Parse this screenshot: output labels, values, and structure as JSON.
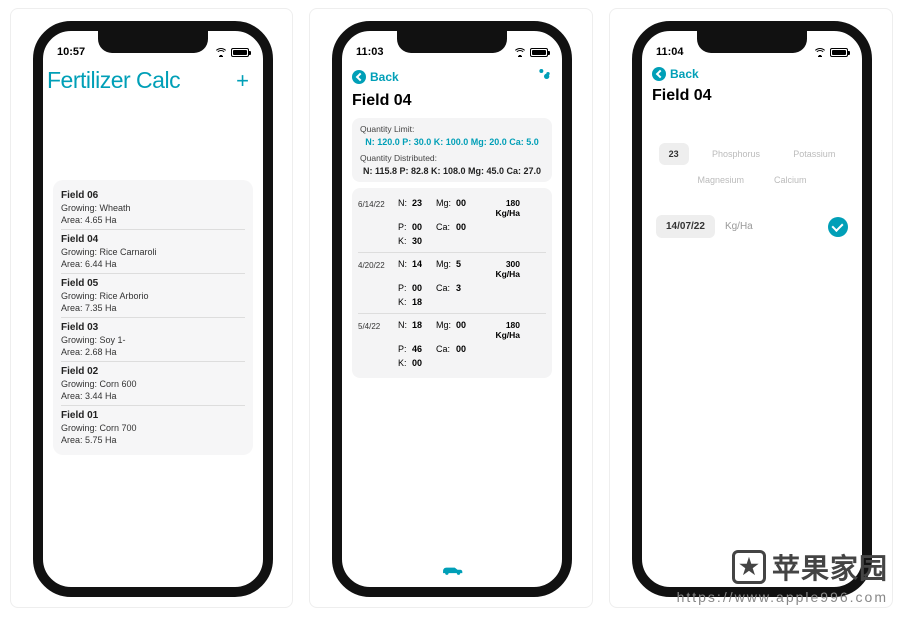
{
  "accent": "#009fb7",
  "watermark": {
    "text": "苹果家园",
    "url": "https://www.apple996.com"
  },
  "screen1": {
    "time": "10:57",
    "title": "Fertilizer Calc",
    "add_label": "+",
    "fields": [
      {
        "name": "Field 06",
        "crop": "Wheath",
        "area": "4.65 Ha"
      },
      {
        "name": "Field 04",
        "crop": "Rice Carnaroli",
        "area": "6.44 Ha"
      },
      {
        "name": "Field 05",
        "crop": "Rice Arborio",
        "area": "7.35 Ha"
      },
      {
        "name": "Field 03",
        "crop": "Soy 1-",
        "area": "2.68 Ha"
      },
      {
        "name": "Field 02",
        "crop": "Corn 600",
        "area": "3.44 Ha"
      },
      {
        "name": "Field 01",
        "crop": "Corn 700",
        "area": "5.75 Ha"
      }
    ]
  },
  "screen2": {
    "time": "11:03",
    "back": "Back",
    "title": "Field 04",
    "limit_label": "Quantity Limit:",
    "limit_value": "N: 120.0 P: 30.0 K: 100.0 Mg: 20.0 Ca: 5.0",
    "dist_label": "Quantity Distributed:",
    "dist_value": "N: 115.8 P: 82.8 K: 108.0 Mg: 45.0 Ca: 27.0",
    "entries": [
      {
        "date": "6/14/22",
        "N": "23",
        "P": "00",
        "K": "30",
        "Mg": "00",
        "Ca": "00",
        "rate": "180 Kg/Ha"
      },
      {
        "date": "4/20/22",
        "N": "14",
        "P": "00",
        "K": "18",
        "Mg": "5",
        "Ca": "3",
        "rate": "300 Kg/Ha"
      },
      {
        "date": "5/4/22",
        "N": "18",
        "P": "46",
        "K": "00",
        "Mg": "00",
        "Ca": "00",
        "rate": "180 Kg/Ha"
      }
    ],
    "labels": {
      "N": "N:",
      "P": "P:",
      "K": "K:",
      "Mg": "Mg:",
      "Ca": "Ca:"
    }
  },
  "screen3": {
    "time": "11:04",
    "back": "Back",
    "title": "Field 04",
    "nutrients": {
      "active_value": "23",
      "phosphorus": "Phosphorus",
      "potassium": "Potassium",
      "magnesium": "Magnesium",
      "calcium": "Calcium"
    },
    "date": "14/07/22",
    "unit": "Kg/Ha"
  }
}
